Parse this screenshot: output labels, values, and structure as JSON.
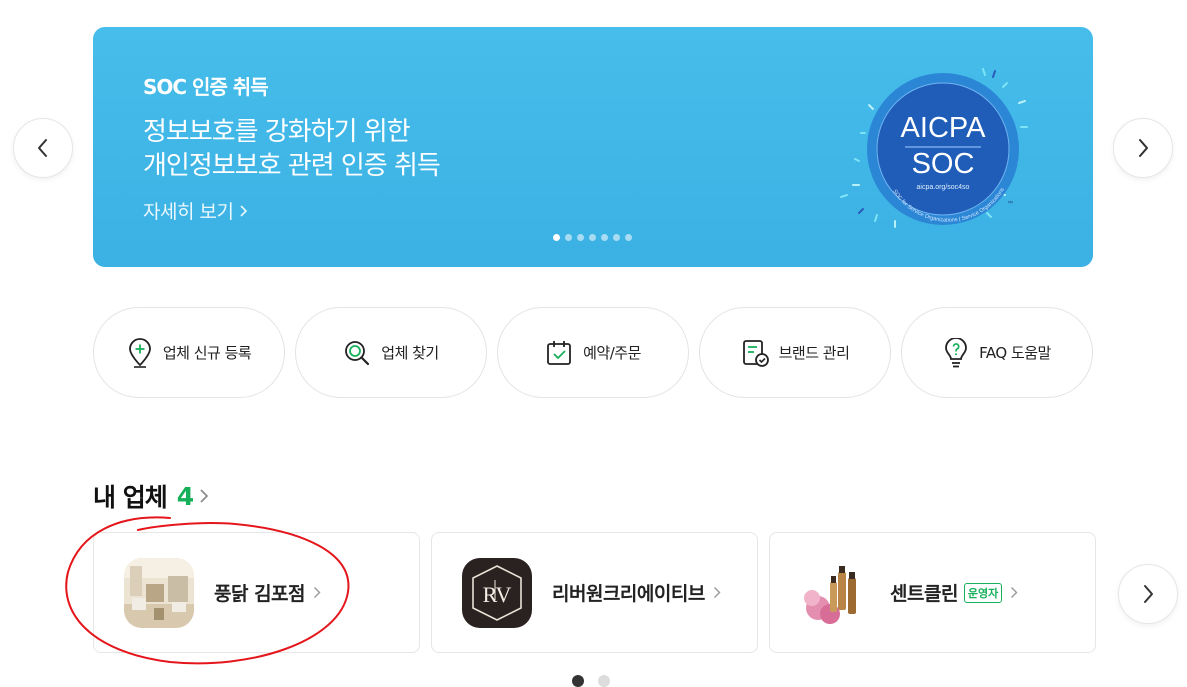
{
  "banner": {
    "eyebrow": "SOC 인증 취득",
    "title_line1": "정보보호를 강화하기 위한",
    "title_line2": "개인정보보호 관련 인증 취득",
    "link": "자세히 보기",
    "seal": {
      "line1": "AICPA",
      "line2": "SOC",
      "url": "aicpa.org/soc4so",
      "ring_text": "SOC for Service Organizations | Service Organizations",
      "tm": "™"
    },
    "slide_count": 7,
    "active_slide": 1
  },
  "quick_menu": [
    {
      "label": "업체 신규 등록",
      "icon": "map-pin-plus-icon"
    },
    {
      "label": "업체 찾기",
      "icon": "search-icon"
    },
    {
      "label": "예약/주문",
      "icon": "calendar-check-icon"
    },
    {
      "label": "브랜드 관리",
      "icon": "document-check-icon"
    },
    {
      "label": "FAQ 도움말",
      "icon": "lightbulb-question-icon"
    }
  ],
  "my_stores": {
    "title": "내 업체",
    "count": "4",
    "items": [
      {
        "name": "풍닭 김포점",
        "badge": ""
      },
      {
        "name": "리버원크리에이티브",
        "badge": ""
      },
      {
        "name": "센트클린",
        "badge": "운영자"
      }
    ],
    "pages": 2,
    "active_page": 1
  },
  "colors": {
    "banner": "#3bb1e4",
    "accent_green": "#16b05a",
    "annotation_red": "#e4161b"
  }
}
